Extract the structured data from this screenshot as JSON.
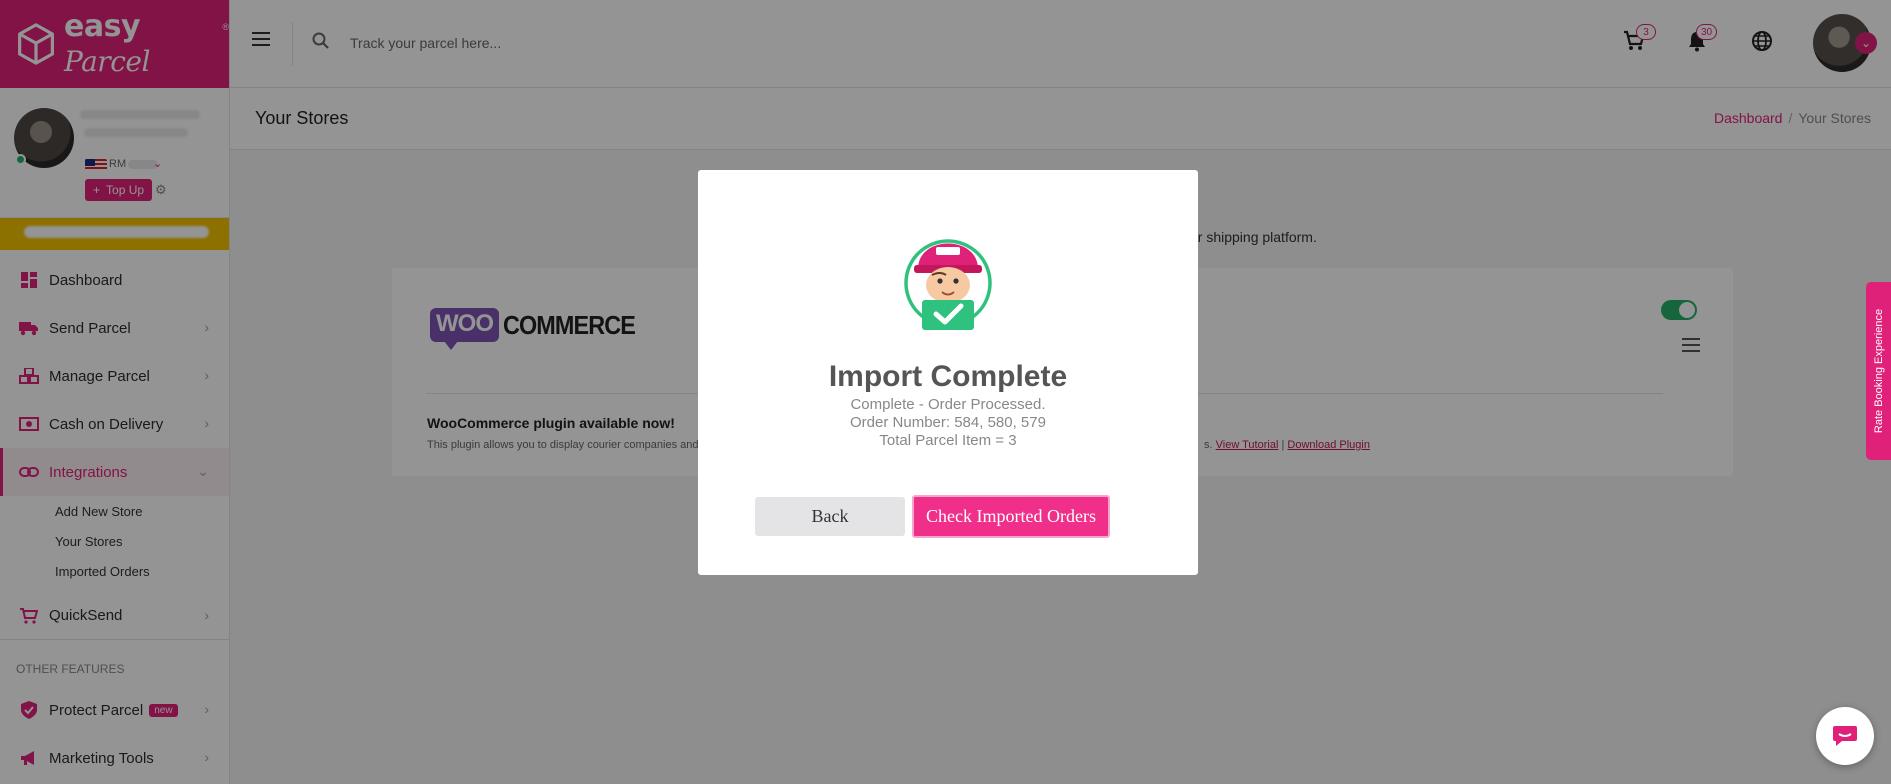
{
  "brand": {
    "name_bold": "easy",
    "name_script": "Parcel",
    "reg": "®"
  },
  "profile": {
    "currency_label": "RM",
    "topup_label": "Top Up"
  },
  "sidebar": {
    "items": [
      {
        "label": "Dashboard",
        "icon": "dashboard-icon"
      },
      {
        "label": "Send Parcel",
        "icon": "truck-icon"
      },
      {
        "label": "Manage Parcel",
        "icon": "boxes-icon"
      },
      {
        "label": "Cash on Delivery",
        "icon": "cash-icon"
      },
      {
        "label": "Integrations",
        "icon": "link-icon"
      },
      {
        "label": "QuickSend",
        "icon": "cart-icon"
      }
    ],
    "subitems": [
      "Add New Store",
      "Your Stores",
      "Imported Orders"
    ],
    "section_label": "OTHER FEATURES",
    "features": [
      {
        "label": "Protect Parcel",
        "badge": "new",
        "icon": "shield-icon"
      },
      {
        "label": "Marketing Tools",
        "icon": "megaphone-icon"
      }
    ]
  },
  "topbar": {
    "search_placeholder": "Track your parcel here...",
    "cart_count": "3",
    "notif_count": "30"
  },
  "page": {
    "title": "Your Stores",
    "breadcrumb": {
      "home": "Dashboard",
      "current": "Your Stores"
    },
    "intro_tail": "ur shipping platform."
  },
  "store_card": {
    "logo_woo": "WOO",
    "logo_commerce": "COMMERCE",
    "plugin_title": "WooCommerce plugin available now!",
    "plugin_desc": "This plugin allows you to display courier companies and",
    "links_prefix": "s.",
    "view_tutorial": "View Tutorial",
    "separator": "|",
    "download_plugin": "Download Plugin",
    "enabled": true
  },
  "modal": {
    "title": "Import Complete",
    "line1": "Complete - Order Processed.",
    "line2": "Order Number: 584, 580, 579",
    "line3": "Total Parcel Item = 3",
    "back_label": "Back",
    "check_label": "Check Imported Orders"
  },
  "side_tab": {
    "label": "Rate Booking Experience"
  },
  "colors": {
    "brand": "#e0217a",
    "success": "#27b06a",
    "overlay": "rgba(0,0,0,0.42)"
  }
}
